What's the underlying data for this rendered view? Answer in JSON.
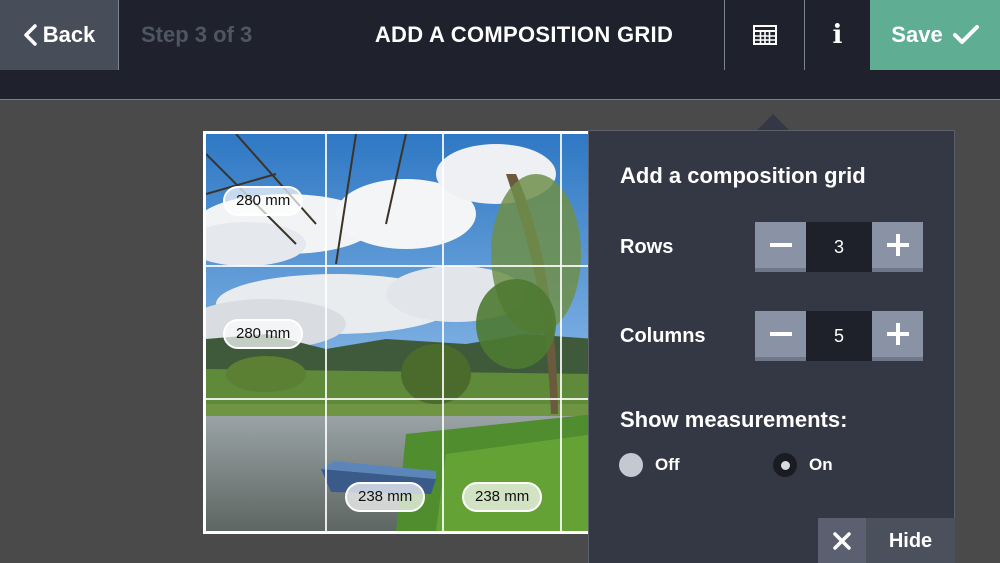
{
  "header": {
    "back_label": "Back",
    "step_label": "Step 3 of 3",
    "title": "ADD A COMPOSITION GRID",
    "grid_icon": "grid-icon",
    "info_icon": "info-icon",
    "info_glyph": "i",
    "save_label": "Save",
    "save_icon": "checkmark-icon",
    "colors": {
      "bar": "#1f222c",
      "back": "#484d5a",
      "save": "#5fae94"
    }
  },
  "canvas": {
    "measurements": {
      "row1": "280 mm",
      "row2": "280 mm",
      "col2": "238 mm",
      "col3": "238 mm"
    }
  },
  "panel": {
    "title": "Add a composition grid",
    "rows_label": "Rows",
    "rows_value": "3",
    "columns_label": "Columns",
    "columns_value": "5",
    "measurements_label": "Show measurements:",
    "off_label": "Off",
    "on_label": "On",
    "selected": "On",
    "hide_label": "Hide",
    "hide_icon": "close-icon"
  }
}
